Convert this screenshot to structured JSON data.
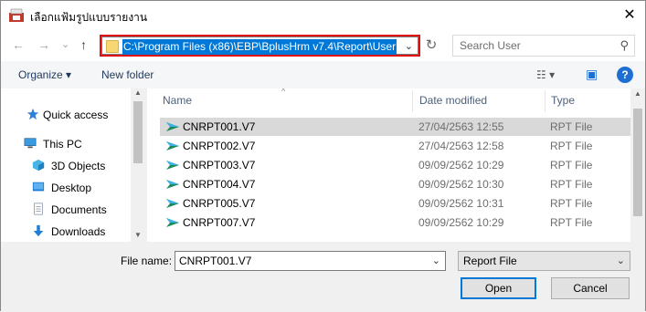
{
  "window": {
    "title": "เลือกแฟ้มรูปแบบรายงาน",
    "close_glyph": "✕"
  },
  "navbar": {
    "back_glyph": "←",
    "forward_glyph": "→",
    "recent_glyph": "⌄",
    "up_glyph": "↑",
    "address": "C:\\Program Files (x86)\\EBP\\BplusHrm v7.4\\Report\\User",
    "refresh_glyph": "↻",
    "search_placeholder": "Search User",
    "search_glyph": "⚲"
  },
  "toolbar": {
    "organize_label": "Organize ▾",
    "new_folder_label": "New folder",
    "view_glyph": "☷ ▾",
    "preview_glyph": "▣",
    "help_glyph": "?"
  },
  "nav_pane": {
    "items": [
      {
        "label": "Quick access",
        "icon": "star-icon"
      },
      {
        "label": "This PC",
        "icon": "pc-icon"
      },
      {
        "label": "3D Objects",
        "icon": "cube-icon"
      },
      {
        "label": "Desktop",
        "icon": "desktop-icon"
      },
      {
        "label": "Documents",
        "icon": "documents-icon"
      },
      {
        "label": "Downloads",
        "icon": "download-icon"
      }
    ]
  },
  "file_list": {
    "columns": {
      "name": "Name",
      "date": "Date modified",
      "type": "Type"
    },
    "rows": [
      {
        "name": "CNRPT001.V7",
        "date": "27/04/2563 12:55",
        "type": "RPT File",
        "selected": true
      },
      {
        "name": "CNRPT002.V7",
        "date": "27/04/2563 12:58",
        "type": "RPT File",
        "selected": false
      },
      {
        "name": "CNRPT003.V7",
        "date": "09/09/2562 10:29",
        "type": "RPT File",
        "selected": false
      },
      {
        "name": "CNRPT004.V7",
        "date": "09/09/2562 10:30",
        "type": "RPT File",
        "selected": false
      },
      {
        "name": "CNRPT005.V7",
        "date": "09/09/2562 10:31",
        "type": "RPT File",
        "selected": false
      },
      {
        "name": "CNRPT007.V7",
        "date": "09/09/2562 10:29",
        "type": "RPT File",
        "selected": false
      }
    ]
  },
  "bottom": {
    "file_name_label": "File name:",
    "file_name_value": "CNRPT001.V7",
    "file_type_value": "Report File",
    "open_label": "Open",
    "cancel_label": "Cancel"
  },
  "colors": {
    "accent": "#0078d7",
    "highlight_border": "#e01010",
    "selection": "#d9d9d9"
  }
}
